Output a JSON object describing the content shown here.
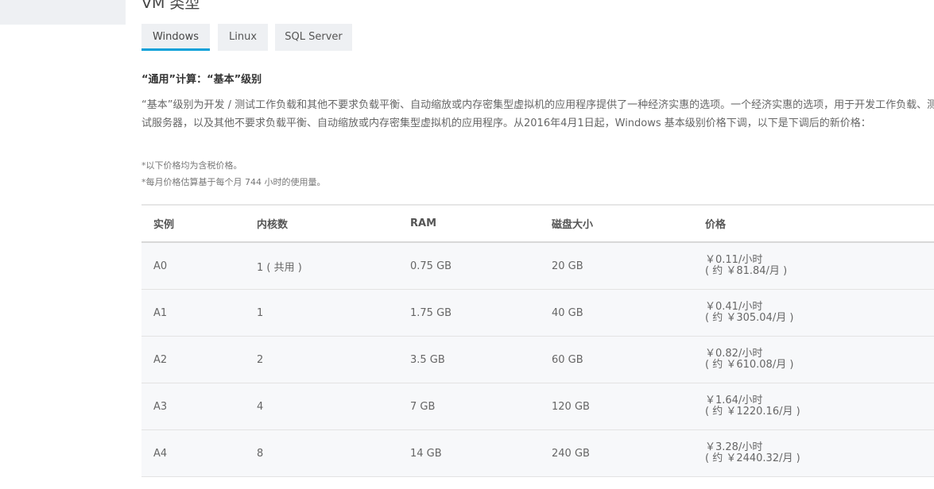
{
  "section_title": "VM 类型",
  "tabs": [
    {
      "label": "Windows",
      "active": true
    },
    {
      "label": "Linux",
      "active": false
    },
    {
      "label": "SQL Server",
      "active": false
    }
  ],
  "subheading": "“通用”计算：“基本”级别",
  "description": "“基本”级别为开发 / 测试工作负载和其他不要求负载平衡、自动缩放或内存密集型虚拟机的应用程序提供了一种经济实惠的选项。一个经济实惠的选项，用于开发工作负载、测试服务器，以及其他不要求负载平衡、自动缩放或内存密集型虚拟机的应用程序。从2016年4月1日起，Windows 基本级别价格下调，以下是下调后的新价格：",
  "notes": [
    "*以下价格均为含税价格。",
    "*每月价格估算基于每个月 744 小时的使用量。"
  ],
  "table": {
    "headers": [
      "实例",
      "内核数",
      "RAM",
      "磁盘大小",
      "价格"
    ],
    "rows": [
      {
        "instance": "A0",
        "cores": "1 ( 共用 )",
        "ram": "0.75 GB",
        "disk": "20 GB",
        "price_hour": "￥0.11/小时",
        "price_month": "( 约 ￥81.84/月 )"
      },
      {
        "instance": "A1",
        "cores": "1",
        "ram": "1.75 GB",
        "disk": "40 GB",
        "price_hour": "￥0.41/小时",
        "price_month": "( 约 ￥305.04/月 )"
      },
      {
        "instance": "A2",
        "cores": "2",
        "ram": "3.5 GB",
        "disk": "60 GB",
        "price_hour": "￥0.82/小时",
        "price_month": "( 约 ￥610.08/月 )"
      },
      {
        "instance": "A3",
        "cores": "4",
        "ram": "7 GB",
        "disk": "120 GB",
        "price_hour": "￥1.64/小时",
        "price_month": "( 约 ￥1220.16/月 )"
      },
      {
        "instance": "A4",
        "cores": "8",
        "ram": "14 GB",
        "disk": "240 GB",
        "price_hour": "￥3.28/小时",
        "price_month": "( 约 ￥2440.32/月 )"
      }
    ]
  },
  "colors": {
    "accent": "#0aa0d8",
    "tab_bg": "#eef0f3",
    "row_bg": "#f7f8fa"
  }
}
